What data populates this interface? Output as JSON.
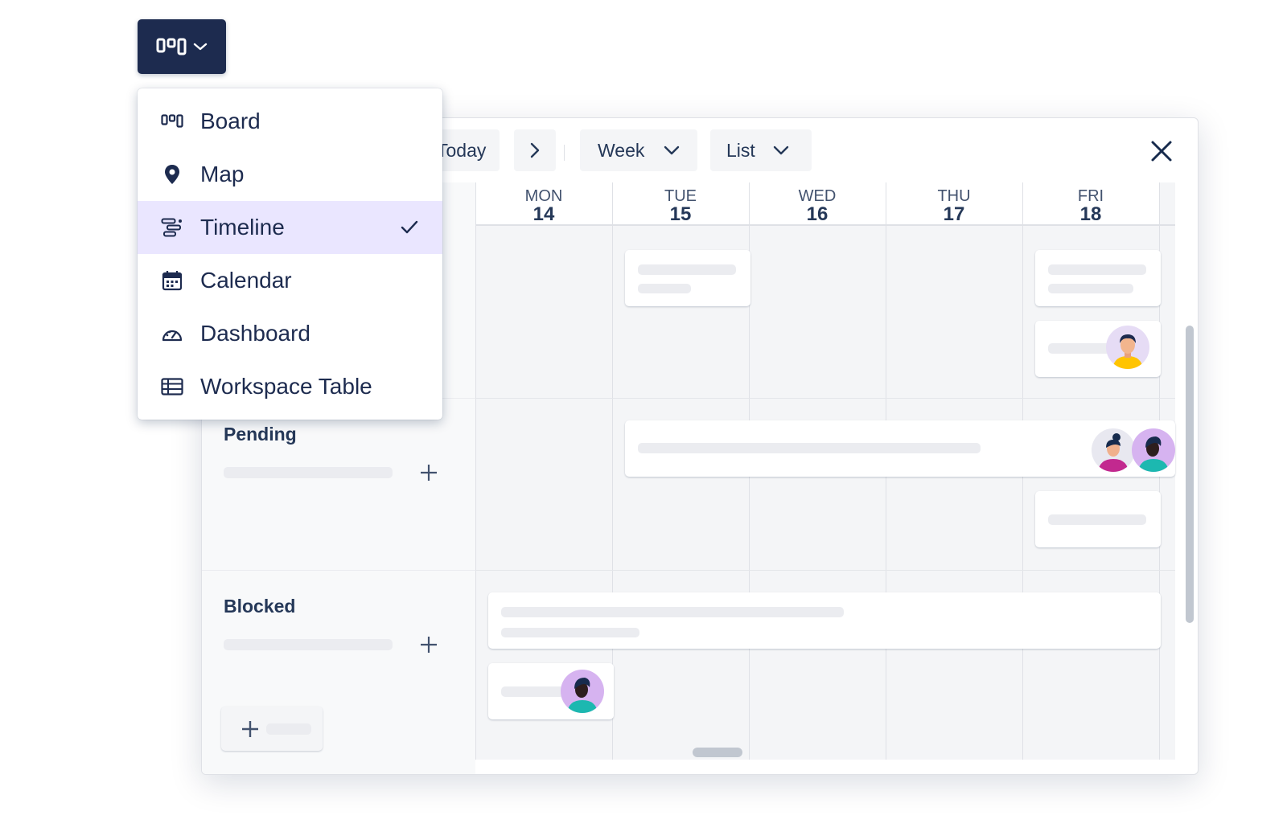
{
  "switcher": {
    "icon": "board-icon",
    "caret": "chevron-down-icon"
  },
  "menu": {
    "items": [
      {
        "label": "Board",
        "icon": "board-icon",
        "selected": false
      },
      {
        "label": "Map",
        "icon": "map-pin-icon",
        "selected": false
      },
      {
        "label": "Timeline",
        "icon": "timeline-icon",
        "selected": true
      },
      {
        "label": "Calendar",
        "icon": "calendar-icon",
        "selected": false
      },
      {
        "label": "Dashboard",
        "icon": "dashboard-icon",
        "selected": false
      },
      {
        "label": "Workspace Table",
        "icon": "table-icon",
        "selected": false
      }
    ]
  },
  "toolbar": {
    "today_label": "Today",
    "week_label": "Week",
    "list_label": "List"
  },
  "calendar": {
    "days": [
      {
        "name": "MON",
        "num": "14"
      },
      {
        "name": "TUE",
        "num": "15"
      },
      {
        "name": "WED",
        "num": "16"
      },
      {
        "name": "THU",
        "num": "17"
      },
      {
        "name": "FRI",
        "num": "18"
      }
    ]
  },
  "groups": [
    {
      "title": "Pending"
    },
    {
      "title": "Blocked"
    }
  ],
  "colors": {
    "navy": "#1d2b4f",
    "selected_bg": "#eae6ff",
    "skeleton": "#ebecf0",
    "grid_bg": "#f4f5f7"
  }
}
